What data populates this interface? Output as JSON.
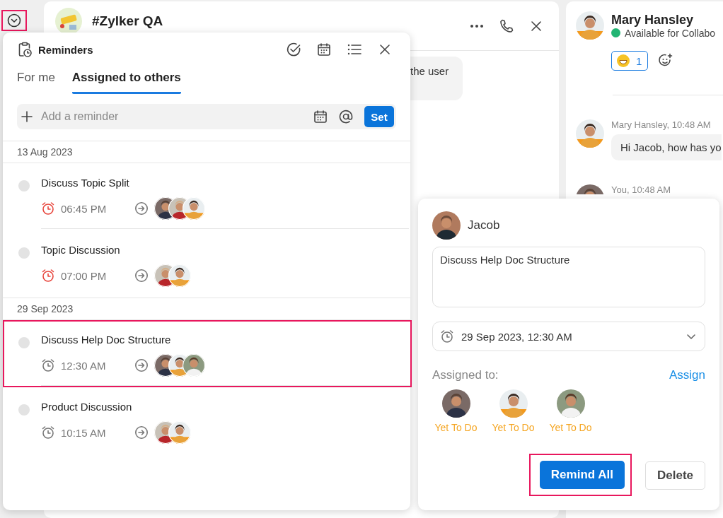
{
  "toggle_button": {
    "highlighted": true
  },
  "chat": {
    "title": "#Zylker QA",
    "bubble_text": "the user"
  },
  "contact": {
    "name": "Mary Hansley",
    "status": "Available for Collabo",
    "reaction_count": "1"
  },
  "messages": [
    {
      "meta": "Mary Hansley, 10:48 AM",
      "text": "Hi Jacob, how has yo",
      "avatar": {
        "kind": "woman_orange"
      }
    },
    {
      "meta": "You, 10:48 AM",
      "avatar": {
        "kind": "man"
      }
    }
  ],
  "reminders": {
    "title": "Reminders",
    "tabs": [
      {
        "label": "For me",
        "selected": false
      },
      {
        "label": "Assigned to others",
        "selected": true
      }
    ],
    "input": {
      "placeholder": "Add a reminder",
      "button": "Set"
    },
    "groups": [
      {
        "date": "13 Aug 2023",
        "items": [
          {
            "title": "Discuss Topic Split",
            "time": "06:45 PM",
            "overdue": true,
            "selected": false,
            "assignees": [
              {
                "kind": "man"
              },
              {
                "kind": "woman_red"
              },
              {
                "kind": "woman_orange"
              }
            ]
          },
          {
            "title": "Topic Discussion",
            "time": "07:00 PM",
            "overdue": true,
            "selected": false,
            "assignees": [
              {
                "kind": "woman_red"
              },
              {
                "kind": "woman_orange"
              }
            ]
          }
        ]
      },
      {
        "date": "29 Sep 2023",
        "items": [
          {
            "title": "Discuss Help Doc Structure",
            "time": "12:30 AM",
            "overdue": false,
            "selected": true,
            "assignees": [
              {
                "kind": "man"
              },
              {
                "kind": "woman_orange"
              },
              {
                "kind": "woman_light"
              }
            ]
          },
          {
            "title": "Product Discussion",
            "time": "10:15 AM",
            "overdue": false,
            "selected": false,
            "assignees": [
              {
                "kind": "woman_red"
              },
              {
                "kind": "woman_orange"
              }
            ]
          }
        ]
      }
    ]
  },
  "detail": {
    "owner": "Jacob",
    "owner_avatar": {
      "kind": "man_suit"
    },
    "description": "Discuss Help Doc Structure",
    "datetime": "29 Sep 2023, 12:30 AM",
    "assigned_label": "Assigned to:",
    "assign_link": "Assign",
    "assignees": [
      {
        "avatar": {
          "kind": "man"
        },
        "status": "Yet To Do"
      },
      {
        "avatar": {
          "kind": "woman_orange"
        },
        "status": "Yet To Do"
      },
      {
        "avatar": {
          "kind": "woman_light"
        },
        "status": "Yet To Do"
      }
    ],
    "buttons": [
      {
        "label": "Remind All",
        "kind": "primary",
        "highlighted": true
      },
      {
        "label": "Delete",
        "kind": "secondary",
        "highlighted": false
      }
    ]
  }
}
